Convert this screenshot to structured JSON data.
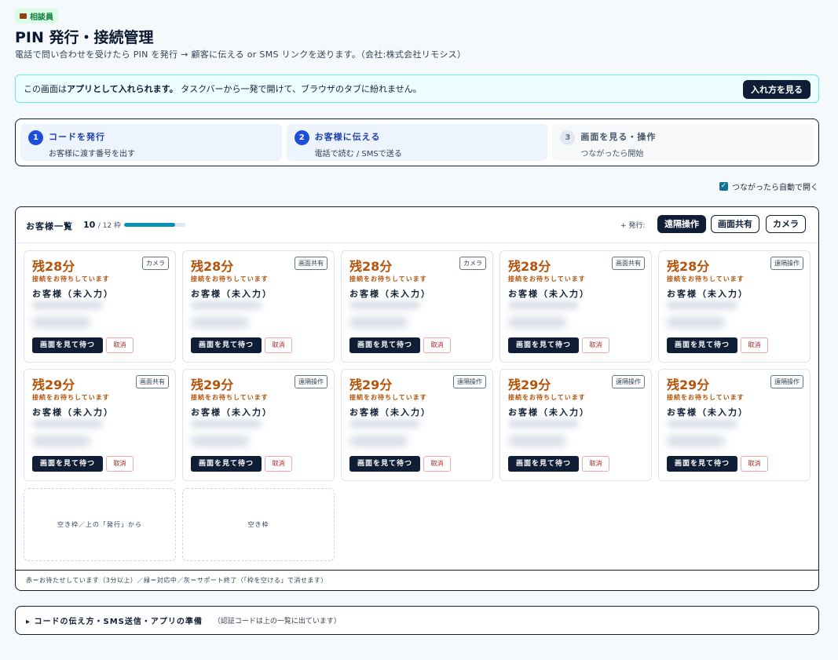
{
  "role_badge": "相談員",
  "header": {
    "title": "PIN 発行・接続管理",
    "subtitle": "電話で問い合わせを受けたら PIN を発行 → 顧客に伝える or SMS リンクを送ります。（会社:株式会社リモシス）"
  },
  "notice": {
    "prefix": "この画面は",
    "emphasis": "アプリとして入れられます。",
    "suffix": "タスクバーから一発で開けて、ブラウザのタブに紛れません。",
    "button": "入れ方を見る"
  },
  "steps": [
    {
      "num": "1",
      "title": "コードを発行",
      "desc": "お客様に渡す番号を出す"
    },
    {
      "num": "2",
      "title": "お客様に伝える",
      "desc": "電話で読む / SMSで送る"
    },
    {
      "num": "3",
      "title": "画面を見る・操作",
      "desc": "つながったら開始"
    }
  ],
  "auto_open": {
    "label": "つながったら自動で開く",
    "checked": true
  },
  "panel": {
    "title": "お客様一覧",
    "count": "10",
    "total": "/ 12 枠",
    "fill_ratio": 0.83,
    "issue_label": "+ 発行:",
    "issue_buttons": [
      "遠隔操作",
      "画面共有",
      "カメラ"
    ]
  },
  "cards": [
    {
      "remain": "残28分",
      "mode": "カメラ"
    },
    {
      "remain": "残28分",
      "mode": "画面共有"
    },
    {
      "remain": "残28分",
      "mode": "カメラ"
    },
    {
      "remain": "残28分",
      "mode": "画面共有"
    },
    {
      "remain": "残28分",
      "mode": "遠隔操作"
    },
    {
      "remain": "残29分",
      "mode": "画面共有"
    },
    {
      "remain": "残29分",
      "mode": "遠隔操作"
    },
    {
      "remain": "残29分",
      "mode": "遠隔操作"
    },
    {
      "remain": "残29分",
      "mode": "遠隔操作"
    },
    {
      "remain": "残29分",
      "mode": "遠隔操作"
    }
  ],
  "card_common": {
    "waiting": "接続をお待ちしています",
    "customer": "お客様（未入力）",
    "view_button": "画面を見て待つ",
    "cancel_button": "取消"
  },
  "empty_slots": [
    "空き枠／上の「発行」から",
    "空き枠"
  ],
  "legend": "赤＝お待たせしています（3分以上）／緑＝対応中／灰＝サポート終了（「枠を空ける」で消せます）",
  "howto": {
    "title": "▸ コードの伝え方・SMS送信・アプリの準備",
    "note": "（認証コードは上の一覧に出ています）"
  },
  "colors": {
    "navy": "#0f1e36",
    "accent_blue": "#1d4ed8",
    "warn_orange": "#b45309",
    "cyan": "#0891b2"
  }
}
